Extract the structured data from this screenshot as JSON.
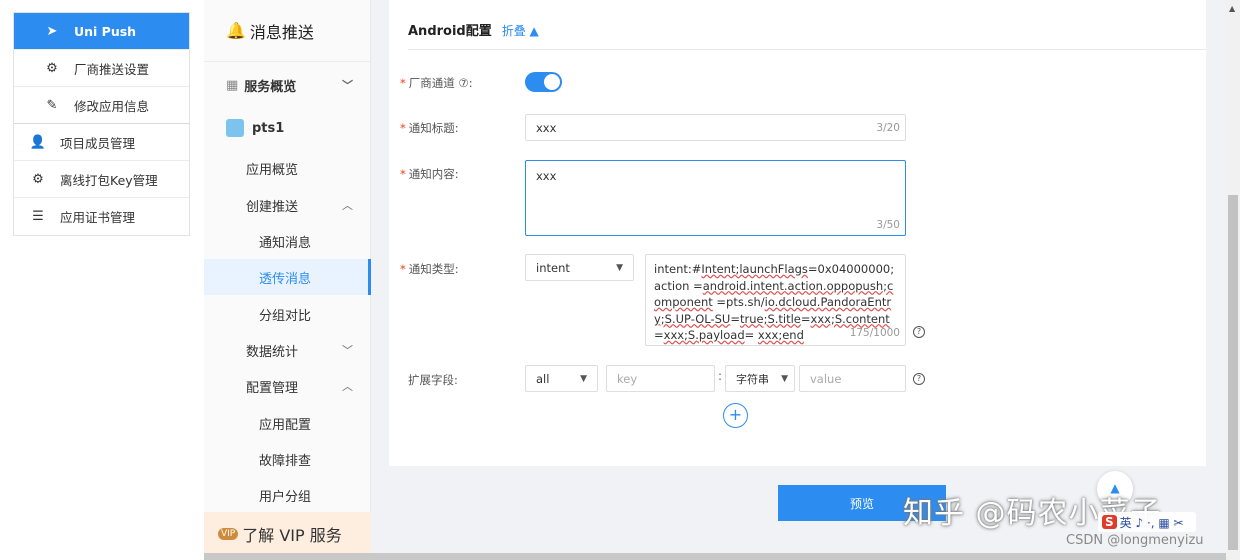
{
  "left_menu": {
    "items": [
      {
        "label": "Uni Push",
        "icon": "send-icon"
      },
      {
        "label": "厂商推送设置",
        "icon": "gear-icon"
      },
      {
        "label": "修改应用信息",
        "icon": "edit-icon"
      },
      {
        "label": "项目成员管理",
        "icon": "user-icon"
      },
      {
        "label": "离线打包Key管理",
        "icon": "gear-icon"
      },
      {
        "label": "应用证书管理",
        "icon": "list-icon"
      }
    ]
  },
  "mid_nav": {
    "title": "消息推送",
    "items": [
      {
        "label": "服务概览"
      },
      {
        "label": "pts1"
      },
      {
        "label": "应用概览"
      },
      {
        "label": "创建推送"
      },
      {
        "label": "通知消息"
      },
      {
        "label": "透传消息"
      },
      {
        "label": "分组对比"
      },
      {
        "label": "数据统计"
      },
      {
        "label": "配置管理"
      },
      {
        "label": "应用配置"
      },
      {
        "label": "故障排查"
      },
      {
        "label": "用户分组"
      }
    ],
    "vip": {
      "badge": "VIP",
      "label": "了解 VIP 服务"
    }
  },
  "form": {
    "section_title": "Android配置",
    "fold_label": "折叠 ▲",
    "vendor_channel": {
      "label": "厂商通道 ⑦:",
      "enabled": true
    },
    "title": {
      "label": "通知标题:",
      "value": "xxx",
      "counter": "3/20"
    },
    "content": {
      "label": "通知内容:",
      "value": "xxx",
      "counter": "3/50"
    },
    "type": {
      "label": "通知类型:",
      "selected": "intent",
      "intent_parts": [
        {
          "text": "intent:#",
          "u": false
        },
        {
          "text": "Intent;launchFlags",
          "u": true
        },
        {
          "text": "=0x04000000;action =",
          "u": false
        },
        {
          "text": "android.intent.action.oppopush;component",
          "u": true
        },
        {
          "text": " =pts.sh/",
          "u": false
        },
        {
          "text": "io.dcloud.PandoraEntry;S.UP-OL-SU",
          "u": true
        },
        {
          "text": "=",
          "u": false
        },
        {
          "text": "true;S.title",
          "u": true
        },
        {
          "text": "=",
          "u": false
        },
        {
          "text": "xxx;S.content",
          "u": true
        },
        {
          "text": "=",
          "u": false
        },
        {
          "text": "xxx;S.payload",
          "u": true
        },
        {
          "text": "= ",
          "u": false
        },
        {
          "text": "xxx;end",
          "u": true
        }
      ],
      "counter": "175/1000"
    },
    "ext": {
      "label": "扩展字段:",
      "scope": "all",
      "key_placeholder": "key",
      "separator": ":",
      "value_type": "字符串",
      "value_placeholder": "value"
    },
    "preview_label": "预览"
  },
  "overlay": {
    "watermark": "知乎 @码农小菜子",
    "csdn": "CSDN @longmenyizu",
    "ime_s": "S",
    "ime_text": "英 ♪ ·, ▦ ✂"
  },
  "colors": {
    "accent": "#2d8cf0",
    "required": "#ed4014",
    "vip_bg": "#fdeee0"
  }
}
